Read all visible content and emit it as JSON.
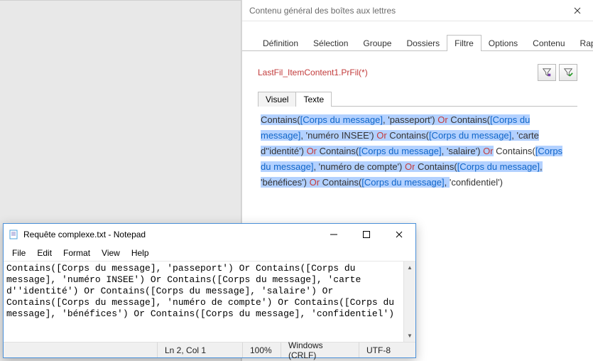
{
  "app": {
    "title": "Contenu général des boîtes aux lettres",
    "tabs": [
      "Définition",
      "Sélection",
      "Groupe",
      "Dossiers",
      "Filtre",
      "Options",
      "Contenu",
      "Rapport"
    ],
    "active_tab_index": 4,
    "expression": "LastFil_ItemContent1.PrFil(*)",
    "sub_tabs": [
      "Visuel",
      "Texte"
    ],
    "active_sub_tab_index": 1,
    "filter_tokens": [
      {
        "t": "fn",
        "v": "Contains(",
        "hl": true
      },
      {
        "t": "fld",
        "v": "[Corps du message]",
        "hl": true
      },
      {
        "t": "fn",
        "v": ", ",
        "hl": true
      },
      {
        "t": "str",
        "v": "'passeport'",
        "hl": true
      },
      {
        "t": "fn",
        "v": ") ",
        "hl": true
      },
      {
        "t": "op",
        "v": "Or",
        "hl": true
      },
      {
        "t": "fn",
        "v": " Contains(",
        "hl": true
      },
      {
        "t": "fld",
        "v": "[Corps du message]",
        "hl": true
      },
      {
        "t": "fn",
        "v": ", ",
        "hl": true
      },
      {
        "t": "str",
        "v": "'numéro INSEE'",
        "hl": true
      },
      {
        "t": "fn",
        "v": ") ",
        "hl": true
      },
      {
        "t": "op",
        "v": "Or",
        "hl": true
      },
      {
        "t": "fn",
        "v": " Contains(",
        "hl": true
      },
      {
        "t": "fld",
        "v": "[Corps du message]",
        "hl": true
      },
      {
        "t": "fn",
        "v": ", ",
        "hl": true
      },
      {
        "t": "str",
        "v": "'carte d''identité'",
        "hl": true
      },
      {
        "t": "fn",
        "v": ") ",
        "hl": true
      },
      {
        "t": "op",
        "v": "Or",
        "hl": true
      },
      {
        "t": "fn",
        "v": " Contains(",
        "hl": true
      },
      {
        "t": "fld",
        "v": "[Corps du message]",
        "hl": true
      },
      {
        "t": "fn",
        "v": ", ",
        "hl": true
      },
      {
        "t": "str",
        "v": "'salaire'",
        "hl": true
      },
      {
        "t": "fn",
        "v": ") ",
        "hl": true
      },
      {
        "t": "op",
        "v": "Or",
        "hl": true
      },
      {
        "t": "fn",
        "v": " Contains(",
        "hl": false
      },
      {
        "t": "fld",
        "v": "[Corps du message]",
        "hl": true
      },
      {
        "t": "fn",
        "v": ", ",
        "hl": true
      },
      {
        "t": "str",
        "v": "'numéro de compte'",
        "hl": true
      },
      {
        "t": "fn",
        "v": ") ",
        "hl": true
      },
      {
        "t": "op",
        "v": "Or",
        "hl": true
      },
      {
        "t": "fn",
        "v": " Contains(",
        "hl": true
      },
      {
        "t": "fld",
        "v": "[Corps du message]",
        "hl": true
      },
      {
        "t": "fn",
        "v": ", ",
        "hl": true
      },
      {
        "t": "str",
        "v": "'bénéfices'",
        "hl": true
      },
      {
        "t": "fn",
        "v": ") ",
        "hl": true
      },
      {
        "t": "op",
        "v": "Or",
        "hl": true
      },
      {
        "t": "fn",
        "v": " Contains(",
        "hl": true
      },
      {
        "t": "fld",
        "v": "[Corps du message]",
        "hl": true
      },
      {
        "t": "fn",
        "v": ", ",
        "hl": true
      },
      {
        "t": "fn",
        "v": "'confidentiel')",
        "hl": false
      }
    ]
  },
  "notepad": {
    "title": "Requête complexe.txt - Notepad",
    "menu": [
      "File",
      "Edit",
      "Format",
      "View",
      "Help"
    ],
    "content": "Contains([Corps du message], 'passeport') Or Contains([Corps du message], 'numéro INSEE') Or Contains([Corps du message], 'carte d''identité') Or Contains([Corps du message], 'salaire') Or Contains([Corps du message], 'numéro de compte') Or Contains([Corps du message], 'bénéfices') Or Contains([Corps du message], 'confidentiel')",
    "status": {
      "pos": "Ln 2, Col 1",
      "zoom": "100%",
      "eol": "Windows (CRLF)",
      "encoding": "UTF-8"
    }
  }
}
